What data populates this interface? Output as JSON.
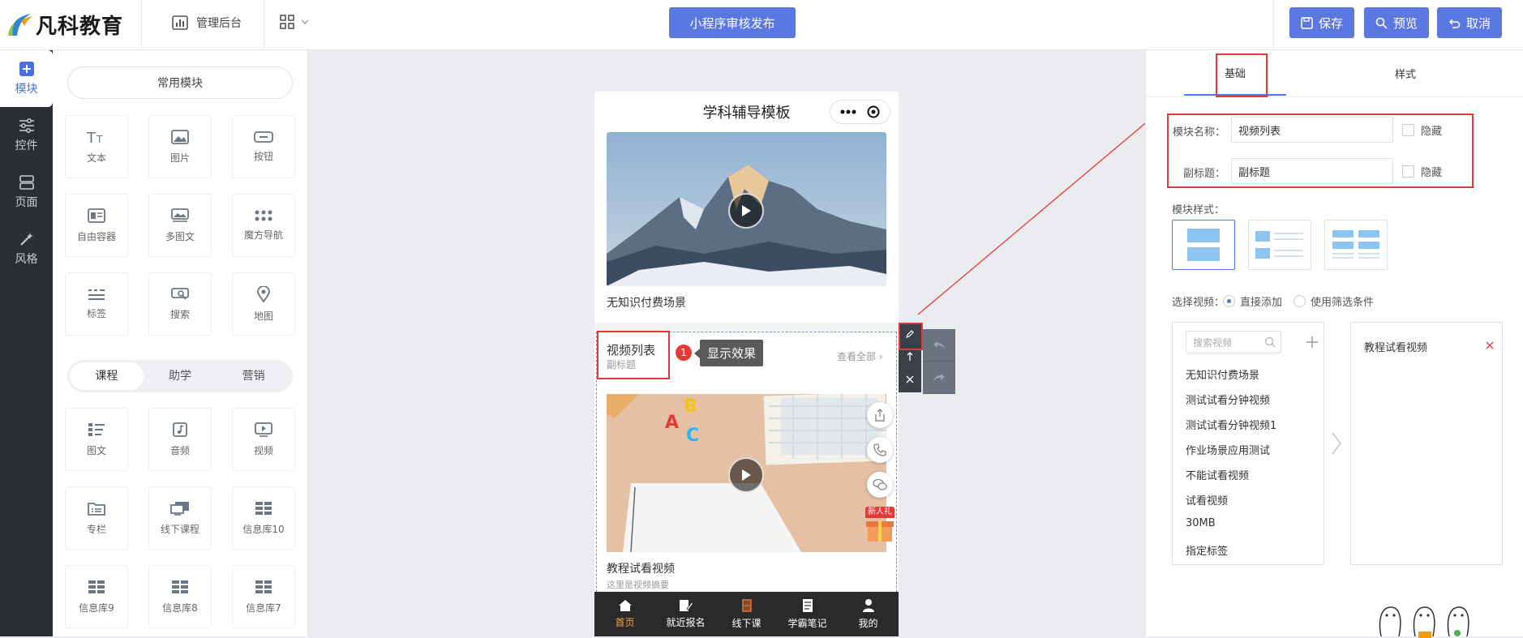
{
  "topbar": {
    "logo_text": "凡科教育",
    "admin_label": "管理后台",
    "publish_label": "小程序审核发布",
    "save_label": "保存",
    "preview_label": "预览",
    "cancel_label": "取消"
  },
  "leftnav": {
    "items": [
      {
        "label": "模块",
        "icon": "plus-square-icon"
      },
      {
        "label": "控件",
        "icon": "sliders-icon"
      },
      {
        "label": "页面",
        "icon": "page-icon"
      },
      {
        "label": "风格",
        "icon": "magic-wand-icon"
      }
    ]
  },
  "palette": {
    "common_title": "常用模块",
    "common": [
      "文本",
      "图片",
      "按钮",
      "自由容器",
      "多图文",
      "魔方导航",
      "标签",
      "搜索",
      "地图"
    ],
    "tabs": [
      "课程",
      "助学",
      "营销"
    ],
    "course": [
      "图文",
      "音频",
      "视频",
      "专栏",
      "线下课程",
      "信息库10",
      "信息库9",
      "信息库8",
      "信息库7"
    ]
  },
  "phone": {
    "title": "学科辅导模板",
    "video1_caption": "无知识付费场景",
    "list_title": "视频列表",
    "list_subtitle": "副标题",
    "view_all": "查看全部",
    "video2_caption": "教程试看视频",
    "video2_summary": "这里是视频摘要",
    "gift_label": "新人礼",
    "tabs": [
      "首页",
      "就近报名",
      "线下课",
      "学霸笔记",
      "我的"
    ]
  },
  "annotation": {
    "badge": "1",
    "tip": "显示效果"
  },
  "panel": {
    "tab_basic": "基础",
    "tab_style": "样式",
    "name_label": "模块名称：",
    "name_value": "视频列表",
    "subtitle_label": "副标题：",
    "subtitle_value": "副标题",
    "hide_label": "隐藏",
    "style_label": "模块样式：",
    "select_video_label": "选择视频：",
    "radio_direct": "直接添加",
    "radio_filter": "使用筛选条件",
    "search_placeholder": "搜索视频",
    "videos": [
      "无知识付费场景",
      "测试试看分钟视频",
      "测试试看分钟视频1",
      "作业场景应用测试",
      "不能试看视频",
      "试看视频",
      "30MB",
      "指定标签"
    ],
    "selected": [
      "教程试看视频"
    ]
  },
  "colors": {
    "accent": "#5b78e0",
    "annotation": "#e53935",
    "tab_active": "#f5a24b"
  }
}
